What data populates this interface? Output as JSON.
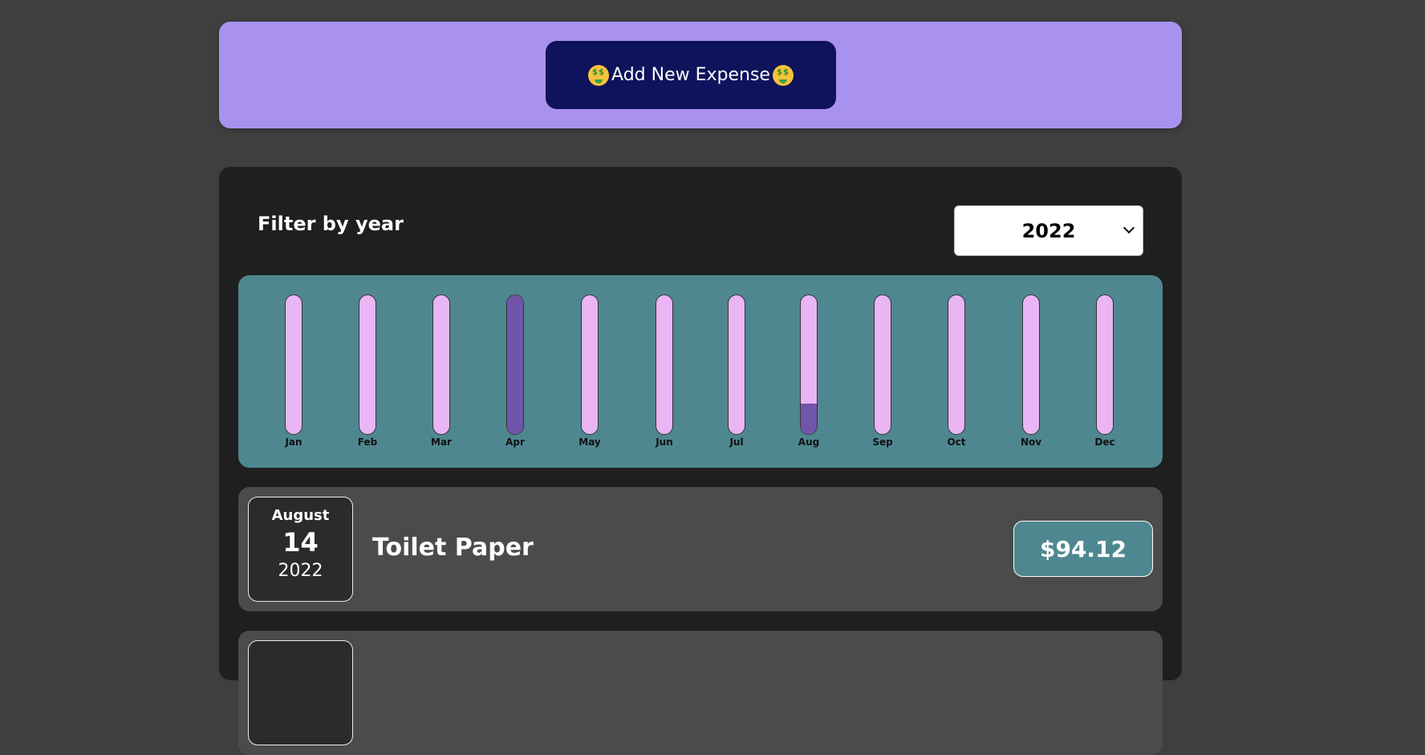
{
  "new_expense": {
    "button_label": "Add New Expense",
    "icon": "money-mouth-face-icon"
  },
  "filter": {
    "label": "Filter by year",
    "selected_year": "2022"
  },
  "chart_data": {
    "type": "bar",
    "categories": [
      "Jan",
      "Feb",
      "Mar",
      "Apr",
      "May",
      "Jun",
      "Jul",
      "Aug",
      "Sep",
      "Oct",
      "Nov",
      "Dec"
    ],
    "values": [
      0,
      0,
      0,
      1.0,
      0,
      0,
      0,
      0.22,
      0,
      0,
      0,
      0
    ],
    "ylim": [
      0,
      1
    ],
    "colors": {
      "track": "#e9b5f4",
      "fill": "#7155ab",
      "background": "#4f8790"
    }
  },
  "expenses": [
    {
      "month": "August",
      "day": "14",
      "year": "2022",
      "title": "Toilet Paper",
      "amount": "$94.12"
    },
    {
      "month": "",
      "day": "",
      "year": "",
      "title": "",
      "amount": ""
    }
  ],
  "colors": {
    "page_bg": "#3f3f3f",
    "new_expense_bg": "#a892ee",
    "button_bg": "#0f135c",
    "panel_bg": "#1f1f1f",
    "item_bg": "#4b4b4b"
  }
}
